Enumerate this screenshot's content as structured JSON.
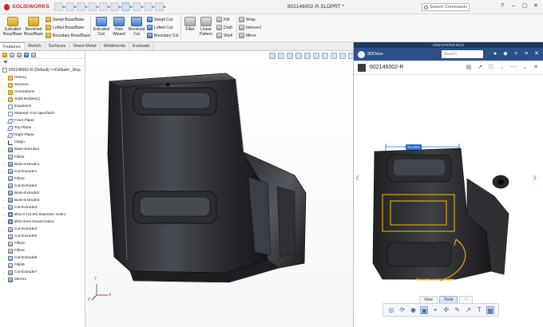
{
  "app": {
    "logo_text": "SOLIDWORKS",
    "document_title": "602146002-R.SLDPRT *",
    "search_placeholder": "Search Commands"
  },
  "window_controls": [
    "?",
    "–",
    "▢",
    "✕"
  ],
  "ribbon": {
    "large": [
      {
        "id": "extruded-boss",
        "label": "Extruded\nBoss/Base"
      },
      {
        "id": "revolved-boss",
        "label": "Revolved\nBoss/Base"
      },
      {
        "id": "extruded-cut",
        "label": "Extruded\nCut"
      },
      {
        "id": "hole-wizard",
        "label": "Hole\nWizard"
      },
      {
        "id": "revolved-cut",
        "label": "Revolved\nCut"
      },
      {
        "id": "fillet",
        "label": "Fillet"
      },
      {
        "id": "linear-pattern",
        "label": "Linear\nPattern"
      }
    ],
    "small": [
      {
        "id": "swept-boss",
        "label": "Swept Boss/Base"
      },
      {
        "id": "lofted-boss",
        "label": "Lofted Boss/Base"
      },
      {
        "id": "boundary-boss",
        "label": "Boundary Boss/Base"
      },
      {
        "id": "swept-cut",
        "label": "Swept Cut"
      },
      {
        "id": "lofted-cut",
        "label": "Lofted Cut"
      },
      {
        "id": "boundary-cut",
        "label": "Boundary Cut"
      },
      {
        "id": "rib",
        "label": "Rib"
      },
      {
        "id": "draft",
        "label": "Draft"
      },
      {
        "id": "shell",
        "label": "Shell"
      },
      {
        "id": "wrap",
        "label": "Wrap"
      },
      {
        "id": "intersect",
        "label": "Intersect"
      },
      {
        "id": "mirror",
        "label": "Mirror"
      }
    ]
  },
  "command_tabs": [
    {
      "label": "Features",
      "active": true
    },
    {
      "label": "Sketch",
      "active": false
    },
    {
      "label": "Surfaces",
      "active": false
    },
    {
      "label": "Sheet Metal",
      "active": false
    },
    {
      "label": "Weldments",
      "active": false
    },
    {
      "label": "Evaluate",
      "active": false
    }
  ],
  "tree": {
    "root": "602146002-R  (Default) <<Default>_Disp",
    "items": [
      {
        "label": "History",
        "icon": "folder",
        "expand": "›"
      },
      {
        "label": "Sensors",
        "icon": "folder",
        "expand": ""
      },
      {
        "label": "Annotations",
        "icon": "folder",
        "expand": "›"
      },
      {
        "label": "Solid Bodies(1)",
        "icon": "folder",
        "expand": "›"
      },
      {
        "label": "Equations",
        "icon": "doc",
        "expand": ""
      },
      {
        "label": "Material <not specified>",
        "icon": "doc",
        "expand": ""
      },
      {
        "label": "Front Plane",
        "icon": "plane",
        "expand": ""
      },
      {
        "label": "Top Plane",
        "icon": "plane",
        "expand": ""
      },
      {
        "label": "Right Plane",
        "icon": "plane",
        "expand": ""
      },
      {
        "label": "Origin",
        "icon": "origin",
        "expand": ""
      },
      {
        "label": "Base-Extrude1",
        "icon": "feat",
        "expand": "›"
      },
      {
        "label": "Fillet1",
        "icon": "fillet",
        "expand": ""
      },
      {
        "label": "Boss-Extrude1",
        "icon": "feat",
        "expand": "›"
      },
      {
        "label": "Cut-Extrude1",
        "icon": "cut",
        "expand": "›"
      },
      {
        "label": "Fillet2",
        "icon": "fillet",
        "expand": ""
      },
      {
        "label": "Cut-Extrude2",
        "icon": "cut",
        "expand": "›"
      },
      {
        "label": "Boss-Extrude2",
        "icon": "feat",
        "expand": "›"
      },
      {
        "label": "Boss-Extrude3",
        "icon": "feat",
        "expand": "›"
      },
      {
        "label": "Cut-Extrude3",
        "icon": "cut",
        "expand": "›"
      },
      {
        "label": "Ø12.0 (12.00) Diameter Hole1",
        "icon": "hole",
        "expand": "›"
      },
      {
        "label": "Ø10.0mm Dowel Hole1",
        "icon": "hole",
        "expand": "›"
      },
      {
        "label": "Cut-Extrude4",
        "icon": "cut",
        "expand": "›"
      },
      {
        "label": "Cut-Extrude5",
        "icon": "cut",
        "expand": ""
      },
      {
        "label": "Fillet3",
        "icon": "fillet",
        "expand": ""
      },
      {
        "label": "Fillet4",
        "icon": "fillet",
        "expand": ""
      },
      {
        "label": "Cut-Extrude6",
        "icon": "cut",
        "expand": "›"
      },
      {
        "label": "Fillet5",
        "icon": "fillet",
        "expand": ""
      },
      {
        "label": "Cut-Extrude7",
        "icon": "cut",
        "expand": "›"
      },
      {
        "label": "Mirror1",
        "icon": "feat",
        "expand": "›"
      }
    ]
  },
  "triad": {
    "x": "X",
    "y": "Y",
    "z": "Z"
  },
  "panel": {
    "brand_strip": "3DEXPERIENCE",
    "app_name": "3DDrive",
    "search_placeholder": "Search",
    "part_title": "602146002-R",
    "dimension_label": "76.2mm",
    "annotation_text": "Pocket w/ thru hole",
    "prev_arrow": "‹",
    "next_arrow": "›",
    "view_tabs": [
      {
        "label": "View",
        "active": false
      },
      {
        "label": "Tools",
        "active": true
      },
      {
        "label": "♡",
        "active": false
      }
    ]
  },
  "colors": {
    "brand_red": "#d72027",
    "panel_blue": "#2d5089",
    "dimension_blue": "#1e6bd1",
    "annotation_yellow": "#f0a000"
  }
}
